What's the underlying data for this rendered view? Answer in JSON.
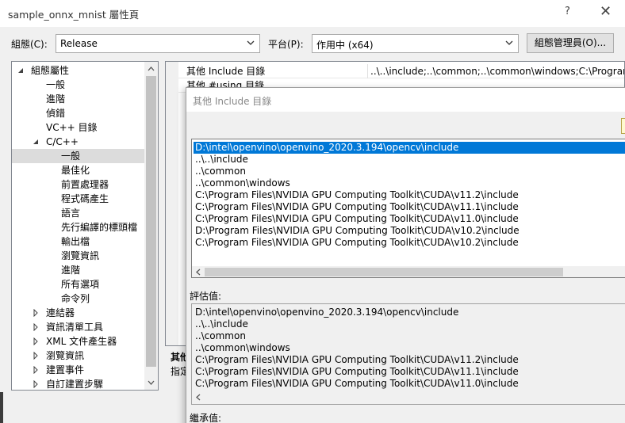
{
  "window": {
    "title": "sample_onnx_mnist 屬性頁",
    "help_glyph": "?",
    "close_glyph": "✕"
  },
  "toolbar": {
    "config_label": "組態(C):",
    "config_value": "Release",
    "platform_label": "平台(P):",
    "platform_value": "作用中 (x64)",
    "config_manager_button": "組態管理員(O)..."
  },
  "tree": {
    "items": [
      {
        "label": "組態屬性",
        "state": "expanded",
        "indent": 0
      },
      {
        "label": "一般",
        "state": "leaf",
        "indent": 1
      },
      {
        "label": "進階",
        "state": "leaf",
        "indent": 1
      },
      {
        "label": "偵錯",
        "state": "leaf",
        "indent": 1
      },
      {
        "label": "VC++ 目錄",
        "state": "leaf",
        "indent": 1
      },
      {
        "label": "C/C++",
        "state": "expanded",
        "indent": 1
      },
      {
        "label": "一般",
        "state": "selected",
        "indent": 2
      },
      {
        "label": "最佳化",
        "state": "leaf",
        "indent": 2
      },
      {
        "label": "前置處理器",
        "state": "leaf",
        "indent": 2
      },
      {
        "label": "程式碼產生",
        "state": "leaf",
        "indent": 2
      },
      {
        "label": "語言",
        "state": "leaf",
        "indent": 2
      },
      {
        "label": "先行編譯的標頭檔",
        "state": "leaf",
        "indent": 2
      },
      {
        "label": "輸出檔",
        "state": "leaf",
        "indent": 2
      },
      {
        "label": "瀏覽資訊",
        "state": "leaf",
        "indent": 2
      },
      {
        "label": "進階",
        "state": "leaf",
        "indent": 2
      },
      {
        "label": "所有選項",
        "state": "leaf",
        "indent": 2
      },
      {
        "label": "命令列",
        "state": "leaf",
        "indent": 2
      },
      {
        "label": "連結器",
        "state": "collapsed",
        "indent": 1
      },
      {
        "label": "資訊清單工具",
        "state": "collapsed",
        "indent": 1
      },
      {
        "label": "XML 文件產生器",
        "state": "collapsed",
        "indent": 1
      },
      {
        "label": "瀏覽資訊",
        "state": "collapsed",
        "indent": 1
      },
      {
        "label": "建置事件",
        "state": "collapsed",
        "indent": 1
      },
      {
        "label": "自訂建置步驟",
        "state": "collapsed",
        "indent": 1
      }
    ]
  },
  "properties": {
    "rows": [
      {
        "name": "其他 Include 目錄",
        "value": "..\\..\\include;..\\common;..\\common\\windows;C:\\Program"
      },
      {
        "name": "其他 #using 目錄",
        "value": ""
      }
    ],
    "description_title": "其他",
    "description_text": "指定"
  },
  "dialog": {
    "title": "其他 Include 目錄",
    "entries": [
      "D:\\intel\\openvino\\openvino_2020.3.194\\opencv\\include",
      "..\\..\\include",
      "..\\common",
      "..\\common\\windows",
      "C:\\Program Files\\NVIDIA GPU Computing Toolkit\\CUDA\\v11.2\\include",
      "C:\\Program Files\\NVIDIA GPU Computing Toolkit\\CUDA\\v11.1\\include",
      "C:\\Program Files\\NVIDIA GPU Computing Toolkit\\CUDA\\v11.0\\include",
      "D:\\Program Files\\NVIDIA GPU Computing Toolkit\\CUDA\\v10.2\\include",
      "C:\\Program Files\\NVIDIA GPU Computing Toolkit\\CUDA\\v10.2\\include"
    ],
    "evaluated_label": "評估值:",
    "evaluated_entries": [
      "D:\\intel\\openvino\\openvino_2020.3.194\\opencv\\include",
      "..\\..\\include",
      "..\\common",
      "..\\common\\windows",
      "C:\\Program Files\\NVIDIA GPU Computing Toolkit\\CUDA\\v11.2\\include",
      "C:\\Program Files\\NVIDIA GPU Computing Toolkit\\CUDA\\v11.1\\include",
      "C:\\Program Files\\NVIDIA GPU Computing Toolkit\\CUDA\\v11.0\\include"
    ],
    "inherited_label": "繼承值:"
  },
  "colors": {
    "selection": "#0078d7",
    "tree_selection": "#dcdcdc"
  }
}
